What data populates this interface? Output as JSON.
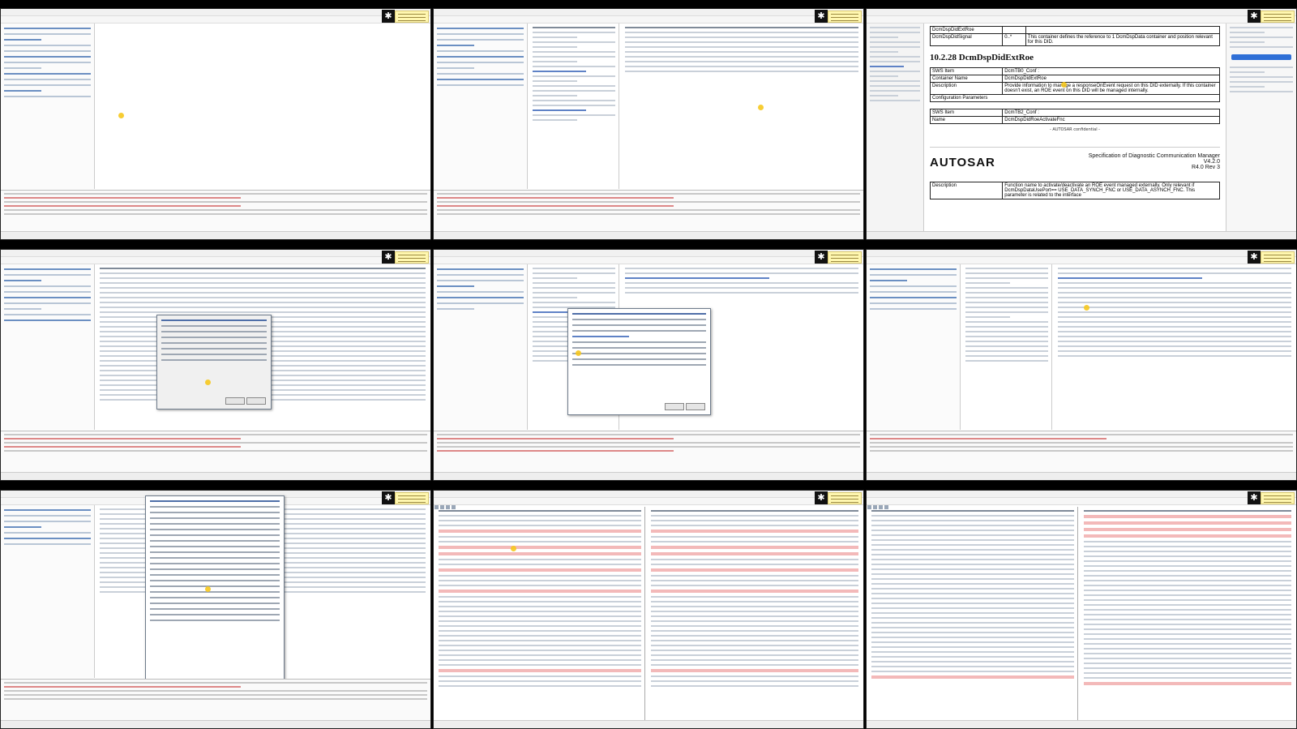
{
  "tiles": [
    {
      "id": 1,
      "kind": "tool"
    },
    {
      "id": 2,
      "kind": "tool-tree"
    },
    {
      "id": 3,
      "kind": "pdf"
    },
    {
      "id": 4,
      "kind": "tool-dialog"
    },
    {
      "id": 5,
      "kind": "tool-dialog"
    },
    {
      "id": 6,
      "kind": "tool-form"
    },
    {
      "id": 7,
      "kind": "tool-dialog"
    },
    {
      "id": 8,
      "kind": "diff"
    },
    {
      "id": 9,
      "kind": "diff"
    }
  ],
  "pdf": {
    "row_top_1_label": "DcmDspDidExtRoe",
    "row_top_2_label": "DcmDspDidSignal",
    "row_top_2_mult": "0..*",
    "row_top_2_desc": "This container defines the reference to 1 DcmDspData container and position relevant for this DID.",
    "section_heading": "10.2.28     DcmDspDidExtRoe",
    "sws_item_label": "SWS Item",
    "sws_item_value": "DcmTB0_Conf :",
    "container_name_label": "Container Name",
    "container_name_value": "DcmDspDidExtRoe",
    "description_label": "Description",
    "description_value": "Provide information to manage a responseOnEvent request on this DID externally. If this container doesn't exist, an ROE event on this DID will be managed internally.",
    "config_params_label": "Configuration Parameters",
    "sws_item2_label": "SWS Item",
    "sws_item2_value": "DcmTB2_Conf :",
    "name_label": "Name",
    "name_value": "DcmDspDidRoeActivateFnc",
    "brand": "AUTOSAR",
    "spec_title": "Specification of Diagnostic Communication Manager",
    "spec_version": "V4.2.0",
    "spec_release": "R4.0 Rev 3",
    "desc2_label": "Description",
    "desc2_value": "Function name to activate/deactivate an ROE event managed externally. Only relevant if DcmDspDataUsePort== USE_DATA_SYNCH_FNC or USE_DATA_ASYNCH_FNC. This parameter is related to the interface",
    "confidential": "- AUTOSAR confidential -"
  },
  "colors": {
    "logo": "#111111",
    "note": "#fff7b0",
    "cursor": "#f6c81e",
    "diff_highlight": "#f3b9b9"
  }
}
